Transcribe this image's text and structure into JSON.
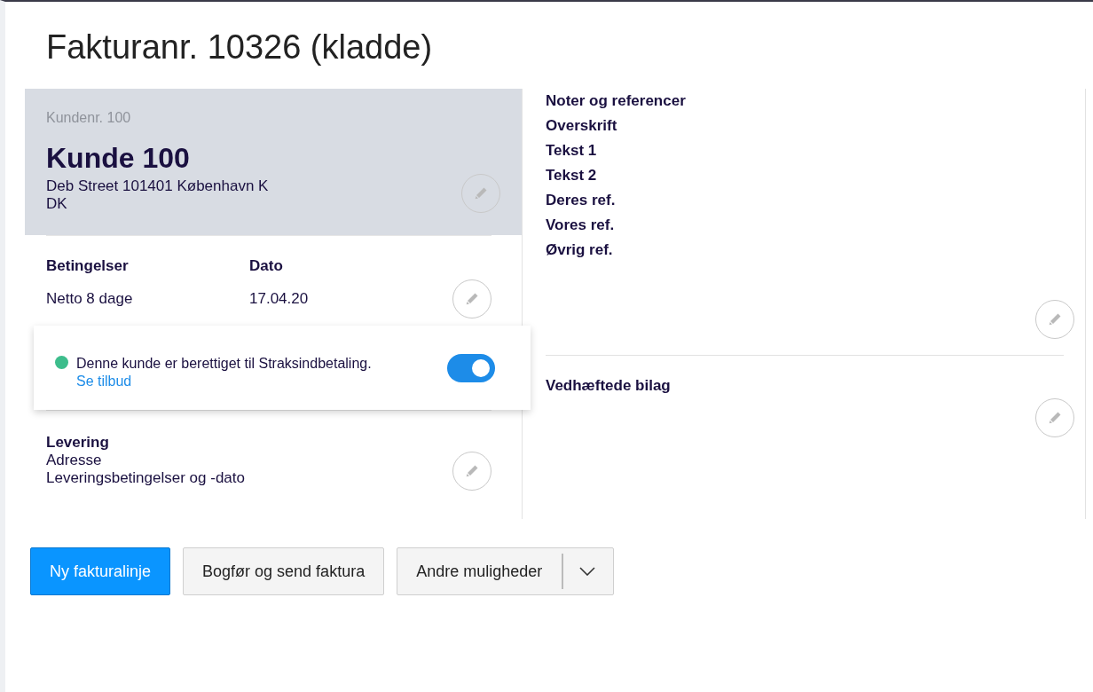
{
  "title": "Fakturanr. 10326 (kladde)",
  "customer": {
    "number_label": "Kundenr. 100",
    "name": "Kunde 100",
    "address_lines": [
      "Deb Street 101401 København K",
      "DK"
    ]
  },
  "terms": [
    {
      "heading": "Betingelser",
      "value": "Netto 8 dage"
    },
    {
      "heading": "Dato",
      "value": "17.04.20"
    }
  ],
  "notice": {
    "message": "Denne kunde er berettiget til Straksindbetaling.",
    "link": "Se tilbud",
    "toggle_on": true
  },
  "delivery": {
    "heading": "Levering",
    "lines": [
      "Adresse",
      "Leveringsbetingelser og -dato"
    ]
  },
  "notes": {
    "items": [
      "Noter og referencer",
      "Overskrift",
      "Tekst 1",
      "Tekst 2",
      "Deres ref.",
      "Vores ref.",
      "Øvrig ref."
    ]
  },
  "attachments": {
    "heading": "Vedhæftede bilag"
  },
  "actions": [
    {
      "label": "Ny fakturalinje",
      "kind": "primary"
    },
    {
      "label": "Bogfør og send faktura",
      "kind": "secondary"
    },
    {
      "label": "Andre muligheder",
      "kind": "split"
    }
  ]
}
